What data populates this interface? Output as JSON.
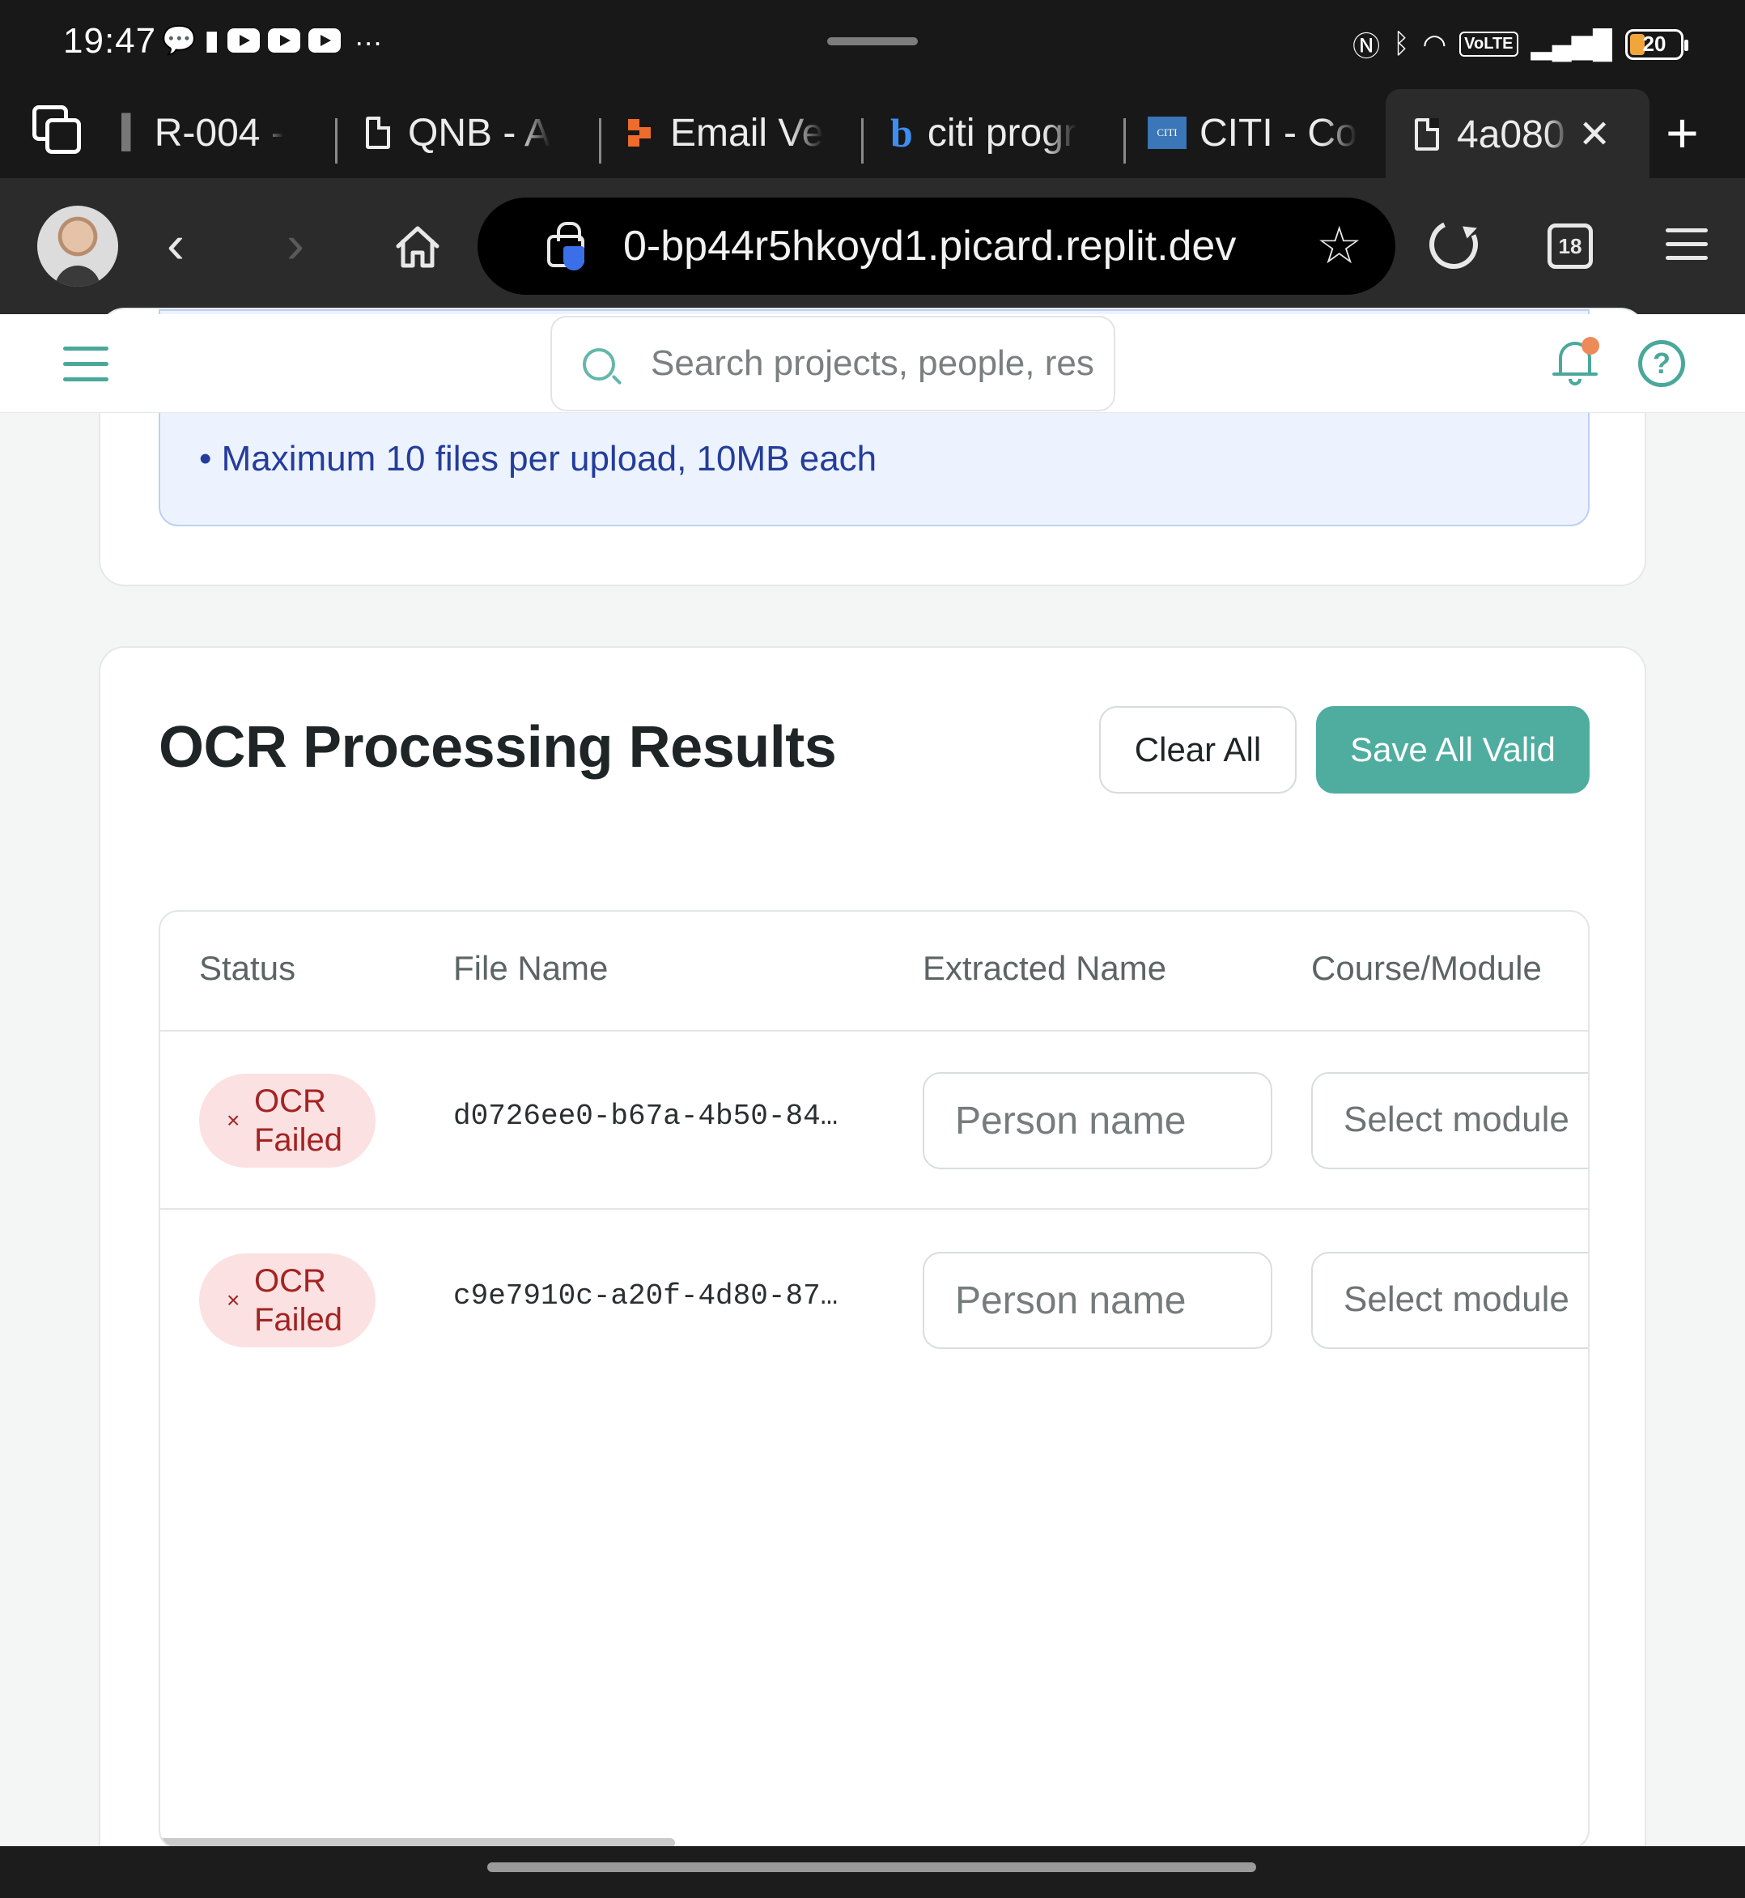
{
  "status_bar": {
    "time": "19:47",
    "notification_icons": [
      "chat-bubble-icon",
      "alert-icon",
      "youtube-icon",
      "youtube-icon",
      "youtube-icon",
      "more-icon"
    ],
    "system_icons": [
      "nfc-icon",
      "bluetooth-icon",
      "wifi-icon",
      "volte-icon",
      "signal-icon",
      "battery-icon"
    ],
    "volte_label": "VoLTE",
    "battery_level": "20"
  },
  "browser": {
    "tabs": [
      {
        "label": "R-004 - ",
        "icon": "generic-icon"
      },
      {
        "label": "QNB - A",
        "icon": "page-icon"
      },
      {
        "label": "Email Ve",
        "icon": "email-icon"
      },
      {
        "label": "citi progr",
        "icon": "bing-icon"
      },
      {
        "label": "CITI - Co",
        "icon": "citi-icon"
      },
      {
        "label": "4a080",
        "icon": "page-icon",
        "active": true
      }
    ],
    "citi_icon_text": "CITI",
    "url": "0-bp44r5hkoyd1.picard.replit.dev",
    "tab_count": "18"
  },
  "app_header": {
    "search_placeholder": "Search projects, people, res"
  },
  "info_box": {
    "line": "• Maximum 10 files per upload, 10MB each"
  },
  "results": {
    "title": "OCR Processing Results",
    "clear_label": "Clear All",
    "save_label": "Save All Valid",
    "columns": [
      "Status",
      "File Name",
      "Extracted Name",
      "Course/Module"
    ],
    "rows": [
      {
        "status_line1": "OCR",
        "status_line2": "Failed",
        "status_icon": "×",
        "file_name": "d0726ee0-b67a-4b50-84…",
        "name_placeholder": "Person name",
        "module_placeholder": "Select module"
      },
      {
        "status_line1": "OCR",
        "status_line2": "Failed",
        "status_icon": "×",
        "file_name": "c9e7910c-a20f-4d80-87…",
        "name_placeholder": "Person name",
        "module_placeholder": "Select module"
      }
    ]
  },
  "colors": {
    "accent": "#4fada0",
    "error_bg": "#fbe1e1",
    "error_text": "#a32323",
    "info_bg": "#edf3fe",
    "info_text": "#243d9c"
  }
}
